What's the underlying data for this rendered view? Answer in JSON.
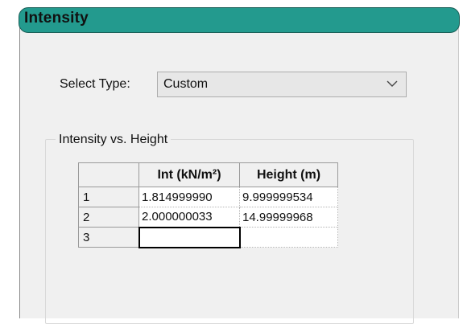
{
  "header": {
    "title": "Intensity"
  },
  "select_type": {
    "label": "Select Type:",
    "value": "Custom"
  },
  "groupbox": {
    "title": "Intensity vs. Height"
  },
  "table": {
    "columns": [
      "Int (kN/m²)",
      "Height (m)"
    ],
    "rows": [
      {
        "row_label": "1",
        "int": "1.814999990",
        "height": "9.999999534"
      },
      {
        "row_label": "2",
        "int": "2.000000033",
        "height": "14.99999968"
      },
      {
        "row_label": "3",
        "int": "",
        "height": ""
      }
    ]
  },
  "colors": {
    "header": "#239a8e",
    "panel": "#f0f0f0"
  },
  "icons": {
    "dropdown": "chevron-down-icon"
  }
}
